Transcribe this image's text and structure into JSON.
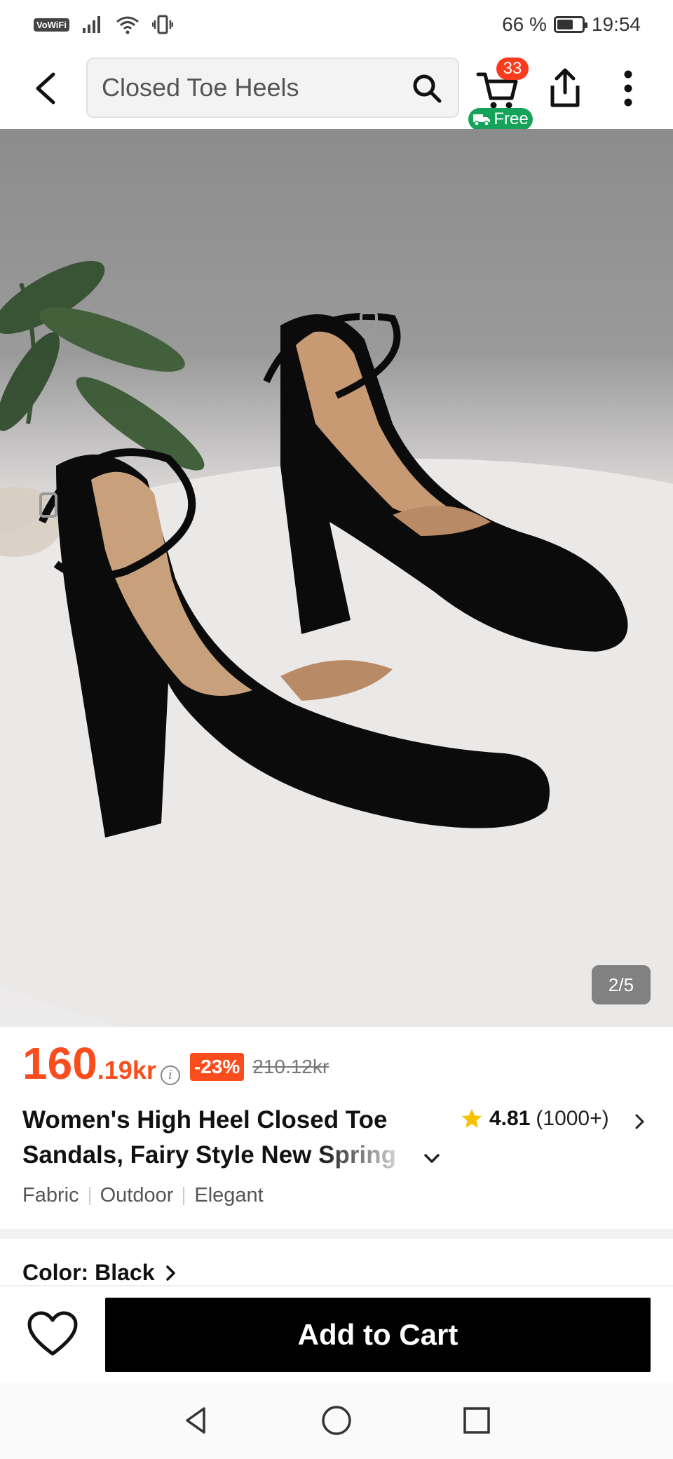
{
  "status_bar": {
    "network_label": "VoWiFi",
    "battery_percent": "66 %",
    "battery_level": 0.66,
    "time": "19:54"
  },
  "header": {
    "search_value": "Closed Toe Heels",
    "cart_count": "33",
    "free_shipping_label": "Free"
  },
  "gallery": {
    "counter": "2/5"
  },
  "product": {
    "price_main": "160",
    "price_cents": ".19kr",
    "discount": "-23%",
    "price_original": "210.12kr",
    "title_line1": "Women's High Heel Closed Toe",
    "title_line2": "Sandals, Fairy Style New Spring",
    "rating": "4.81",
    "rating_count": "(1000+)",
    "tags": [
      "Fabric",
      "Outdoor",
      "Elegant"
    ],
    "color_label": "Color: Black"
  },
  "bottom": {
    "add_to_cart": "Add to Cart"
  },
  "colors": {
    "accent_price": "#fa4d1d",
    "badge_red": "#fa3b1d",
    "free_green": "#15a35a",
    "star_yellow": "#f5c400",
    "button_black": "#000000"
  }
}
